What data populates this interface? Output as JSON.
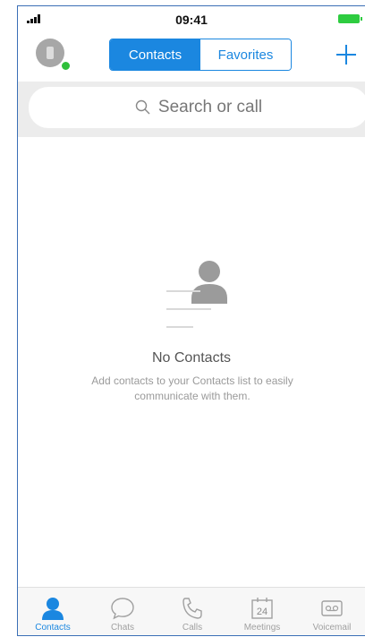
{
  "status_bar": {
    "time": "09:41",
    "icons": [
      "signal-icon",
      "battery-icon"
    ]
  },
  "header": {
    "segments": [
      {
        "label": "Contacts",
        "active": true
      },
      {
        "label": "Favorites",
        "active": false
      }
    ],
    "add_icon": "plus-icon"
  },
  "search": {
    "placeholder": "Search or call",
    "icon": "search-icon"
  },
  "empty_state": {
    "title": "No Contacts",
    "description": "Add contacts to your Contacts list to easily communicate with them."
  },
  "tabs": [
    {
      "label": "Contacts",
      "icon": "contacts-icon",
      "active": true
    },
    {
      "label": "Chats",
      "icon": "chat-icon",
      "active": false
    },
    {
      "label": "Calls",
      "icon": "phone-icon",
      "active": false
    },
    {
      "label": "Meetings",
      "icon": "calendar-icon",
      "calendar_day": "24",
      "active": false
    },
    {
      "label": "Voicemail",
      "icon": "voicemail-icon",
      "active": false
    }
  ],
  "colors": {
    "accent": "#1b87e0",
    "presence": "#2fbf3b",
    "battery": "#2ecc40"
  }
}
